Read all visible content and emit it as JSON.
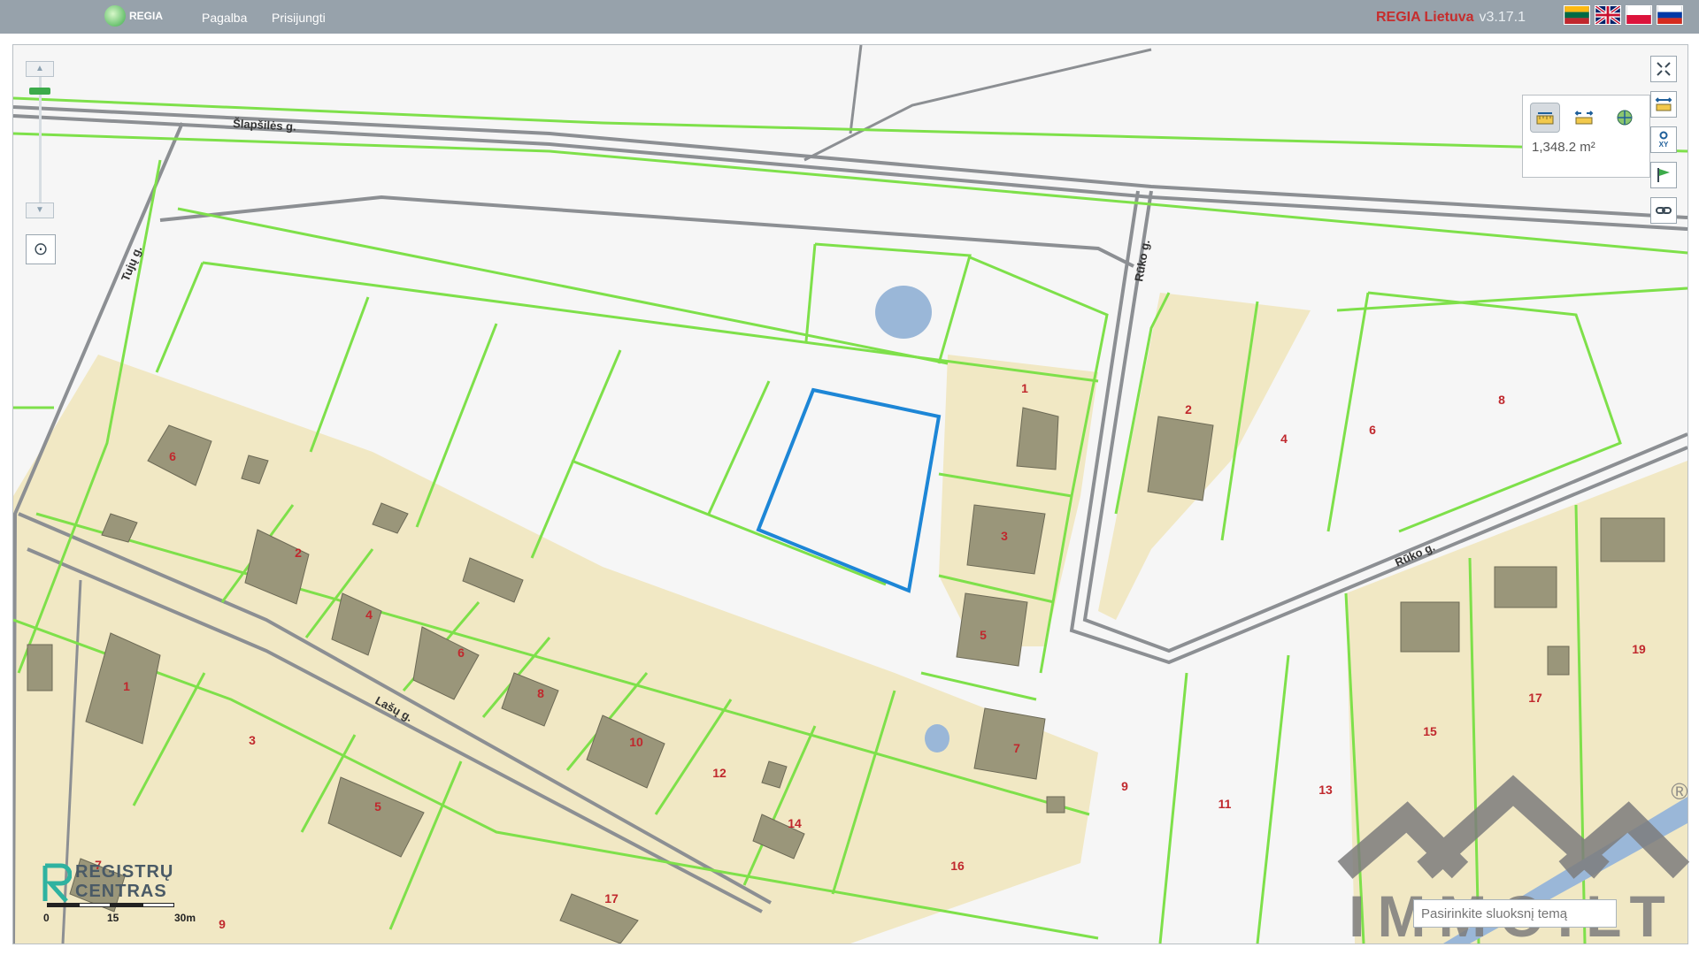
{
  "header": {
    "logo_text": "REGIA",
    "nav": [
      {
        "label": "Pagalba"
      },
      {
        "label": "Prisijungti"
      }
    ],
    "brand": "REGIA Lietuva",
    "version": "v3.17.1",
    "flags": [
      "lithuania-flag",
      "uk-flag",
      "poland-flag",
      "russia-flag"
    ]
  },
  "map_controls": {
    "zoom_in": "▲",
    "zoom_out": "▼",
    "locate": "⊙"
  },
  "measure": {
    "value": "1,348.2 m²"
  },
  "tool_buttons": [
    "fullscreen-icon",
    "measure-icon",
    "xy-coordinates-icon",
    "flag-icon",
    "link-icon"
  ],
  "labels": {
    "streets": [
      "Šlapšilės g.",
      "Tujų g.",
      "Rūko g.",
      "Rūko g.",
      "Lašų g."
    ],
    "parcel_numbers": [
      "1",
      "2",
      "3",
      "4",
      "5",
      "6",
      "7",
      "8",
      "9",
      "10",
      "11",
      "12",
      "13",
      "14",
      "15",
      "16",
      "17",
      "19",
      "6",
      "8",
      "2",
      "4",
      "6",
      "1",
      "3",
      "5",
      "7",
      "9",
      "17"
    ]
  },
  "registru": {
    "line1": "REGISTRŲ",
    "line2": "CENTRAS"
  },
  "scale": {
    "labels": [
      "0",
      "15",
      "30m"
    ]
  },
  "search": {
    "placeholder": "Pasirinkite sluoksnį temą"
  },
  "watermark": {
    "text": "IMMO.LT",
    "mark": "®"
  }
}
